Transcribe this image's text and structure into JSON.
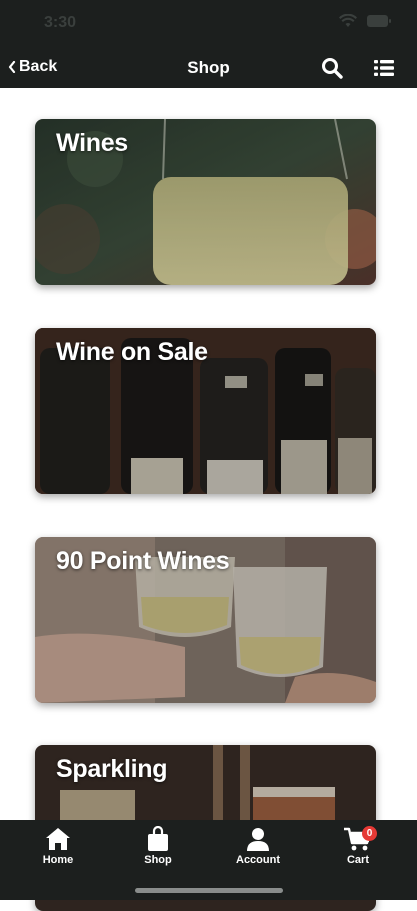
{
  "status": {
    "time": "3:30"
  },
  "nav": {
    "back_label": "Back",
    "title": "Shop"
  },
  "cards": [
    {
      "title": "Wines"
    },
    {
      "title": "Wine on Sale"
    },
    {
      "title": "90 Point Wines"
    },
    {
      "title": "Sparkling"
    }
  ],
  "tabbar": {
    "tabs": [
      {
        "label": "Home",
        "icon": "home-icon"
      },
      {
        "label": "Shop",
        "icon": "shopping-bag-icon"
      },
      {
        "label": "Account",
        "icon": "person-icon"
      },
      {
        "label": "Cart",
        "icon": "cart-icon"
      }
    ],
    "cart_badge": "0"
  },
  "colors": {
    "bar": "#1c1f1e",
    "badge": "#e53935"
  }
}
